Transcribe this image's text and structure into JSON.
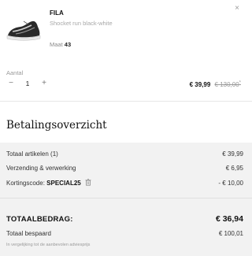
{
  "product": {
    "brand": "FILA",
    "description": "Shocket run black-white",
    "size_label": "Maat",
    "size_value": "43",
    "close_label": "×",
    "image_icon": "sneaker-image"
  },
  "quantity": {
    "label": "Aantal",
    "minus": "−",
    "value": "1",
    "plus": "+"
  },
  "price": {
    "current": "€ 39,99",
    "original": "€ 130,00",
    "original_marker": "*"
  },
  "summary": {
    "title": "Betalingsoverzicht",
    "rows": [
      {
        "label": "Totaal artikelen (1)",
        "value": "€ 39,99"
      },
      {
        "label": "Verzending & verwerking",
        "value": "€ 6,95"
      },
      {
        "label": "Kortingscode:",
        "code": "SPECIAL25",
        "value": "- € 10,00"
      }
    ],
    "trash_icon": "trash-icon",
    "total_label": "TOTAALBEDRAG:",
    "total_value": "€ 36,94",
    "saved_label": "Totaal bespaard",
    "saved_value": "€ 100,01",
    "note": "In vergelijking tot de aanbevolen adviesprijs"
  }
}
